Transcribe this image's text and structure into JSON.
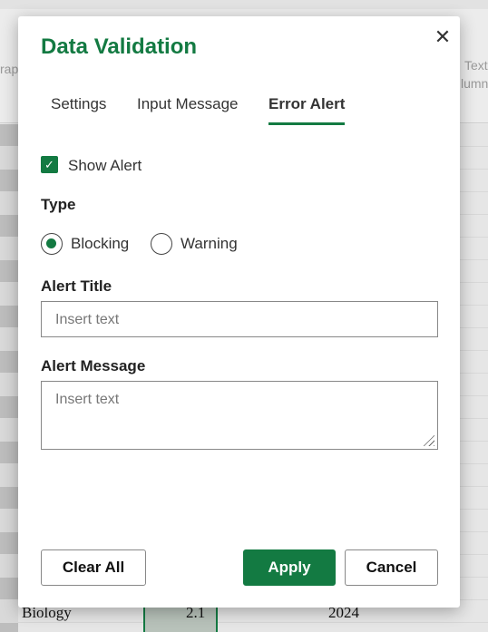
{
  "background": {
    "ribbon_left": "rap",
    "ribbon_right_1": "Text",
    "ribbon_right_2": "lumn",
    "row": {
      "label": "Biology",
      "value": "2.1",
      "year": "2024"
    }
  },
  "dialog": {
    "title": "Data Validation",
    "close_icon": "close-icon",
    "tabs": [
      {
        "label": "Settings"
      },
      {
        "label": "Input Message"
      },
      {
        "label": "Error Alert",
        "active": true
      }
    ],
    "show_alert": {
      "label": "Show Alert",
      "checked": true
    },
    "type": {
      "heading": "Type",
      "options": [
        {
          "label": "Blocking",
          "selected": true
        },
        {
          "label": "Warning",
          "selected": false
        }
      ]
    },
    "alert_title": {
      "label": "Alert Title",
      "placeholder": "Insert text",
      "value": ""
    },
    "alert_message": {
      "label": "Alert Message",
      "placeholder": "Insert text",
      "value": ""
    },
    "buttons": {
      "clear": "Clear All",
      "apply": "Apply",
      "cancel": "Cancel"
    }
  },
  "colors": {
    "accent": "#137a42"
  }
}
